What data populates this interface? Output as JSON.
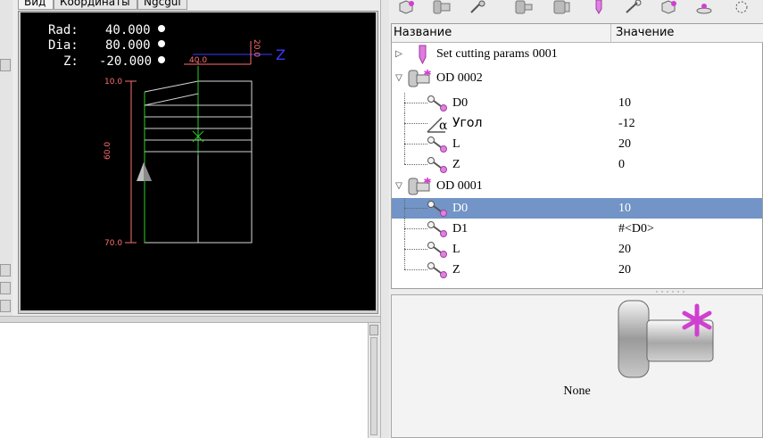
{
  "tabs": [
    {
      "label": "Вид",
      "active": true
    },
    {
      "label": "Координаты",
      "active": false
    },
    {
      "label": "Ngcgui",
      "active": false
    }
  ],
  "dro": {
    "rad_label": "Rad:",
    "rad_value": "40.000",
    "dia_label": "Dia:",
    "dia_value": "80.000",
    "z_label": "Z:",
    "z_value": "-20.000"
  },
  "preview_ticks": {
    "x_top": "40.0",
    "z_top": "20.0",
    "y_top": "10.0",
    "y_mid": "60.0",
    "y_bottom": "70.0",
    "axis_label": "Z"
  },
  "tree": {
    "col_name": "Название",
    "col_value": "Значение",
    "rows": [
      {
        "label": "Set cutting params 0001",
        "value": "",
        "icon": "cutting-tool-icon",
        "expander": "collapsed"
      },
      {
        "label": "OD 0002",
        "value": "",
        "icon": "od-turning-icon",
        "expander": "expanded"
      },
      {
        "label": "D0",
        "value": "10",
        "icon": "param-icon"
      },
      {
        "label": "Угол",
        "value": "-12",
        "icon": "angle-icon"
      },
      {
        "label": "L",
        "value": "20",
        "icon": "param-icon"
      },
      {
        "label": "Z",
        "value": "0",
        "icon": "param-icon"
      },
      {
        "label": "OD 0001",
        "value": "",
        "icon": "od-turning-icon",
        "expander": "expanded"
      },
      {
        "label": "D0",
        "value": "10",
        "icon": "param-icon",
        "selected": true
      },
      {
        "label": "D1",
        "value": "#<D0>",
        "icon": "param-icon"
      },
      {
        "label": "L",
        "value": "20",
        "icon": "param-icon"
      },
      {
        "label": "Z",
        "value": "20",
        "icon": "param-icon"
      }
    ]
  },
  "preview": {
    "label": "None"
  },
  "toolbar": {
    "icons": [
      "part-add-icon",
      "od-icon",
      "gear-tool-icon",
      "id-icon",
      "face-icon",
      "cutting-tool-icon",
      "thread-icon",
      "group-icon",
      "drill-icon",
      "circle-icon"
    ]
  },
  "colors": {
    "selection": "#7294c6",
    "accent_magenta": "#e040e0",
    "axis_blue": "#3a3aff"
  }
}
